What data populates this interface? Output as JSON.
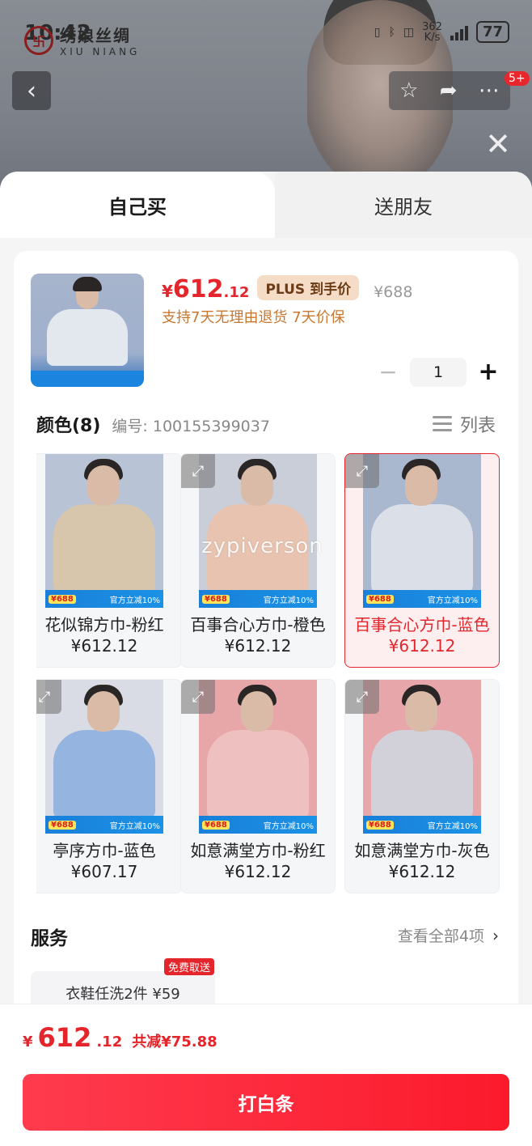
{
  "status": {
    "time": "10:42",
    "net_speed": "362",
    "net_unit": "K/s",
    "battery": "77"
  },
  "brand": {
    "logo_char": "卐",
    "name_cn": "绣娘丝绸",
    "name_en": "XIU NIANG"
  },
  "nav": {
    "back": "‹",
    "badge": "5+",
    "close": "✕"
  },
  "tabs": {
    "self": "自己买",
    "friend": "送朋友"
  },
  "product": {
    "price_currency": "¥",
    "price_int": "612",
    "price_dec": ".12",
    "plus_tag": "PLUS 到手价",
    "original_price": "¥688",
    "guarantee": "支持7天无理由退货  7天价保",
    "quantity": "1",
    "minus": "−",
    "plus": "+"
  },
  "colors": {
    "title": "颜色(8)",
    "code": "编号: 100155399037",
    "list_toggle": "列表",
    "items": [
      {
        "label": "花似锦方巾-粉红 ¥612.12",
        "scarf": "#d9c7a8",
        "bg": "#b9c3d6",
        "selected": false
      },
      {
        "label": "百事合心方巾-橙色 ¥612.12",
        "scarf": "#e9c2ad",
        "bg": "#c9ced9",
        "selected": false
      },
      {
        "label": "百事合心方巾-蓝色 ¥612.12",
        "scarf": "#dfe3ea",
        "bg": "#a9b7cf",
        "selected": true
      },
      {
        "label": "亭序方巾-蓝色 ¥607.17",
        "scarf": "#8fb0e0",
        "bg": "#d9dce4",
        "selected": false
      },
      {
        "label": "如意满堂方巾-粉红 ¥612.12",
        "scarf": "#efc3c2",
        "bg": "#e7a7a9",
        "selected": false
      },
      {
        "label": "如意满堂方巾-灰色 ¥612.12",
        "scarf": "#d0d5de",
        "bg": "#e7a6aa",
        "selected": false
      }
    ],
    "strip_price": "¥688",
    "strip_text": "官方立减10%",
    "watermark": "zypiverson"
  },
  "service": {
    "title": "服务",
    "view_all": "查看全部4项",
    "chevron": "›",
    "chip": "衣鞋任洗2件  ¥59",
    "chip_badge": "免费取送"
  },
  "footer": {
    "currency": "¥",
    "total_int": "612",
    "total_dec": ".12",
    "saving": "共减¥75.88",
    "buy_label": "打白条"
  },
  "colors_theme": {
    "accent": "#e4262c",
    "plus_bg": "#f5dcc6",
    "guarantee": "#c8772f"
  }
}
